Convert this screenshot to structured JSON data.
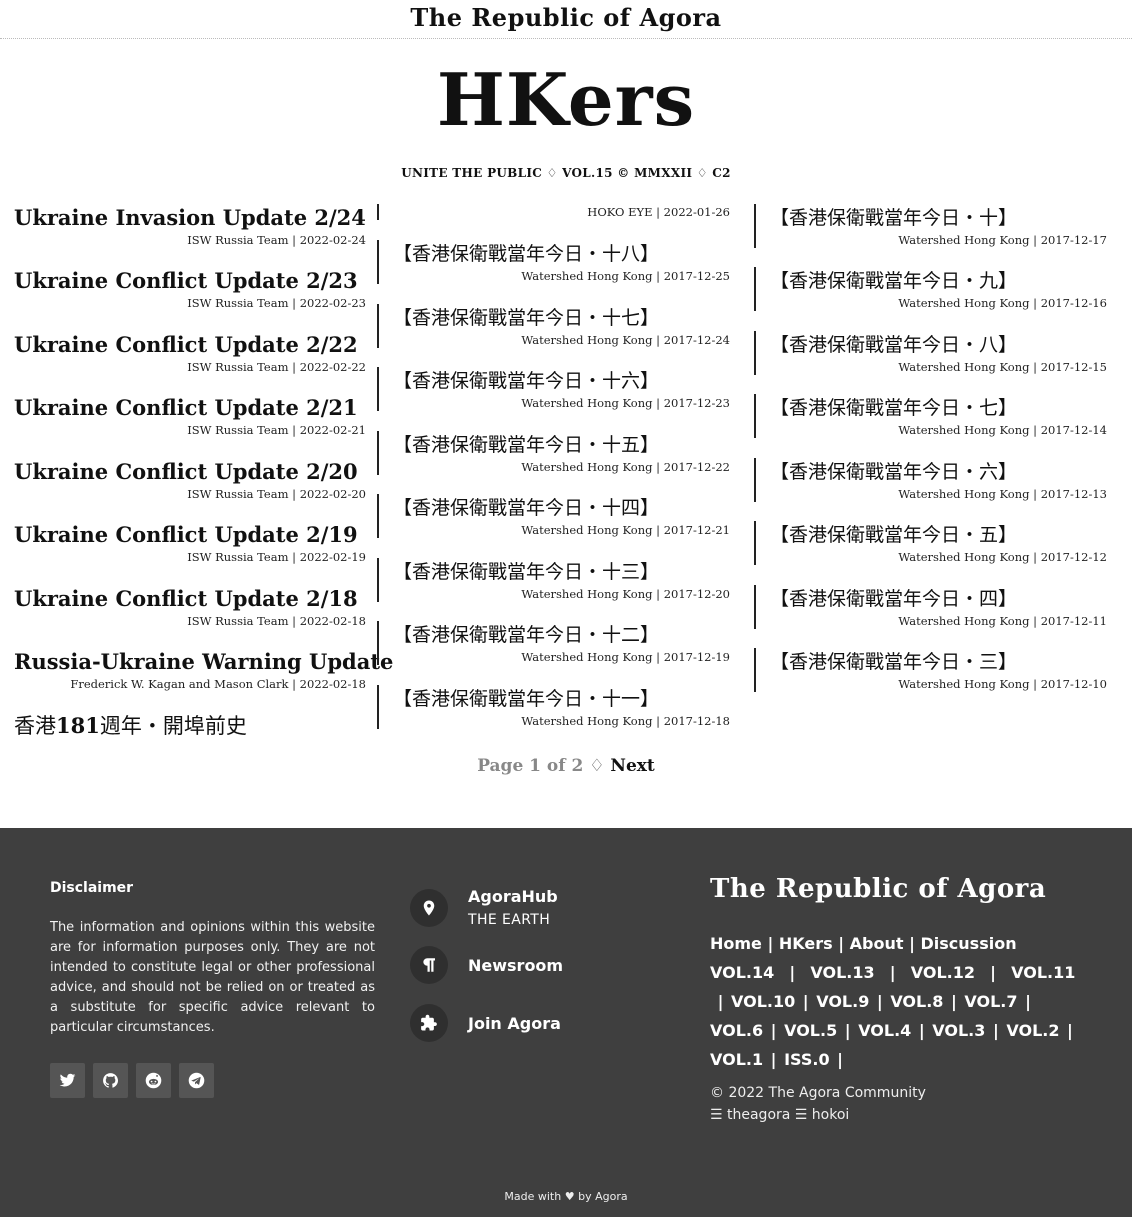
{
  "site": {
    "top_title": "The Republic of Agora",
    "logo": "HKers",
    "tagline": "UNITE THE PUBLIC ♢ VOL.15 © MMXXII ♢ C2"
  },
  "col1": [
    {
      "title": "Ukraine Invasion Update 2/24",
      "meta": "ISW Russia Team | 2022-02-24"
    },
    {
      "title": "Ukraine Conflict Update 2/23",
      "meta": "ISW Russia Team | 2022-02-23"
    },
    {
      "title": "Ukraine Conflict Update 2/22",
      "meta": "ISW Russia Team | 2022-02-22"
    },
    {
      "title": "Ukraine Conflict Update 2/21",
      "meta": "ISW Russia Team | 2022-02-21"
    },
    {
      "title": "Ukraine Conflict Update 2/20",
      "meta": "ISW Russia Team | 2022-02-20"
    },
    {
      "title": "Ukraine Conflict Update 2/19",
      "meta": "ISW Russia Team | 2022-02-19"
    },
    {
      "title": "Ukraine Conflict Update 2/18",
      "meta": "ISW Russia Team | 2022-02-18"
    },
    {
      "title": "Russia-Ukraine Warning Update",
      "meta": "Frederick W. Kagan and Mason Clark | 2022-02-18"
    }
  ],
  "col1_last": {
    "prefix": "香港",
    "number": "181",
    "suffix": "週年・開埠前史"
  },
  "col2_first_meta": "HOKO EYE | 2022-01-26",
  "col2": [
    {
      "title": "【香港保衛戰當年今日・十八】",
      "meta": "Watershed Hong Kong | 2017-12-25"
    },
    {
      "title": "【香港保衛戰當年今日・十七】",
      "meta": "Watershed Hong Kong | 2017-12-24"
    },
    {
      "title": "【香港保衛戰當年今日・十六】",
      "meta": "Watershed Hong Kong | 2017-12-23"
    },
    {
      "title": "【香港保衛戰當年今日・十五】",
      "meta": "Watershed Hong Kong | 2017-12-22"
    },
    {
      "title": "【香港保衛戰當年今日・十四】",
      "meta": "Watershed Hong Kong | 2017-12-21"
    },
    {
      "title": "【香港保衛戰當年今日・十三】",
      "meta": "Watershed Hong Kong | 2017-12-20"
    },
    {
      "title": "【香港保衛戰當年今日・十二】",
      "meta": "Watershed Hong Kong | 2017-12-19"
    },
    {
      "title": "【香港保衛戰當年今日・十一】",
      "meta": "Watershed Hong Kong | 2017-12-18"
    }
  ],
  "col3": [
    {
      "title": "【香港保衛戰當年今日・十】",
      "meta": "Watershed Hong Kong | 2017-12-17"
    },
    {
      "title": "【香港保衛戰當年今日・九】",
      "meta": "Watershed Hong Kong | 2017-12-16"
    },
    {
      "title": "【香港保衛戰當年今日・八】",
      "meta": "Watershed Hong Kong | 2017-12-15"
    },
    {
      "title": "【香港保衛戰當年今日・七】",
      "meta": "Watershed Hong Kong | 2017-12-14"
    },
    {
      "title": "【香港保衛戰當年今日・六】",
      "meta": "Watershed Hong Kong | 2017-12-13"
    },
    {
      "title": "【香港保衛戰當年今日・五】",
      "meta": "Watershed Hong Kong | 2017-12-12"
    },
    {
      "title": "【香港保衛戰當年今日・四】",
      "meta": "Watershed Hong Kong | 2017-12-11"
    },
    {
      "title": "【香港保衛戰當年今日・三】",
      "meta": "Watershed Hong Kong | 2017-12-10"
    }
  ],
  "pager": {
    "status": "Page 1 of 2",
    "sep": "♢",
    "next": "Next"
  },
  "footer": {
    "disclaimer_title": "Disclaimer",
    "disclaimer_text": "The information and opinions within this website are for information purposes only. They are not intended to constitute legal or other professional advice, and should not be relied on or treated as a substitute for specific advice relevant to particular circumstances.",
    "socials": [
      "twitter-icon",
      "github-icon",
      "reddit-icon",
      "telegram-icon"
    ],
    "hub_label": "AgoraHub",
    "hub_sub": "THE EARTH",
    "newsroom_label": "Newsroom",
    "join_label": "Join Agora",
    "republic": "The Republic of Agora",
    "nav_links": [
      "Home",
      "HKers",
      "About",
      "Discussion"
    ],
    "vol_links": [
      "VOL.14",
      "VOL.13",
      "VOL.12",
      "VOL.11",
      "VOL.10",
      "VOL.9",
      "VOL.8",
      "VOL.7",
      "VOL.6",
      "VOL.5",
      "VOL.4",
      "VOL.3",
      "VOL.2",
      "VOL.1",
      "ISS.0"
    ],
    "copyright": "© 2022 The Agora Community",
    "credits": "☰ theagora ☰ hokoi",
    "made_with_prefix": "Made with",
    "made_with_suffix": "by Agora"
  },
  "colors": {
    "footer_bg": "#3f3f3f",
    "text": "#111111"
  }
}
